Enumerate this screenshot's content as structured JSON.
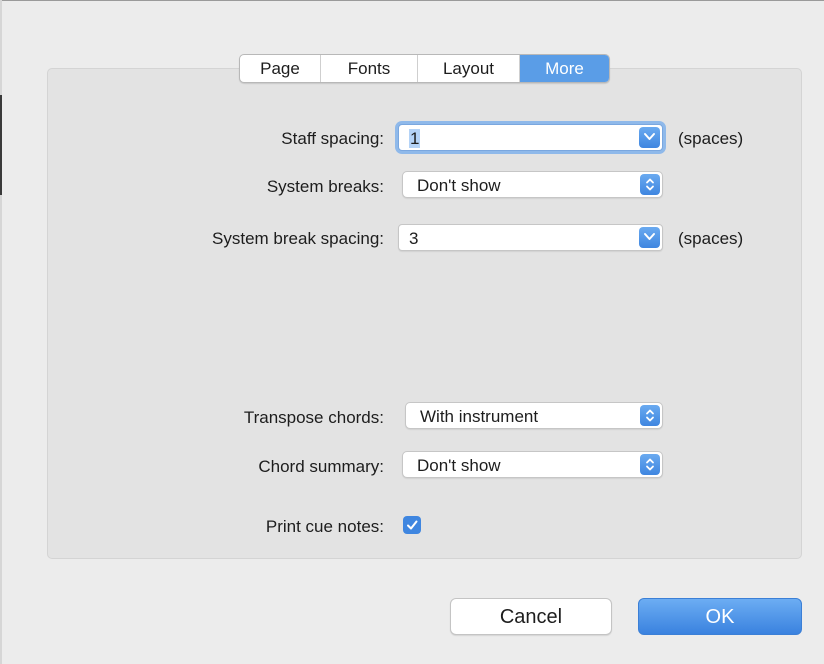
{
  "tabs": [
    {
      "label": "Page",
      "active": false
    },
    {
      "label": "Fonts",
      "active": false
    },
    {
      "label": "Layout",
      "active": false
    },
    {
      "label": "More",
      "active": true
    }
  ],
  "fields": {
    "staff_spacing": {
      "label": "Staff spacing:",
      "value": "1",
      "units": "(spaces)"
    },
    "system_breaks": {
      "label": "System breaks:",
      "value": "Don't show"
    },
    "system_break_spacing": {
      "label": "System break spacing:",
      "value": "3",
      "units": "(spaces)"
    },
    "transpose_chords": {
      "label": "Transpose chords:",
      "value": "With instrument"
    },
    "chord_summary": {
      "label": "Chord summary:",
      "value": "Don't show"
    },
    "print_cue_notes": {
      "label": "Print cue notes:",
      "checked": true
    }
  },
  "buttons": {
    "cancel": "Cancel",
    "ok": "OK"
  },
  "colors": {
    "accent": "#3f86e0",
    "tab_active": "#5a9de7",
    "panel": "#e3e3e3",
    "background": "#ececec"
  },
  "icons": {
    "combo_arrow": "chevron-down-icon",
    "popup_arrows": "updown-chevron-icon",
    "checkbox": "checkmark-icon"
  }
}
